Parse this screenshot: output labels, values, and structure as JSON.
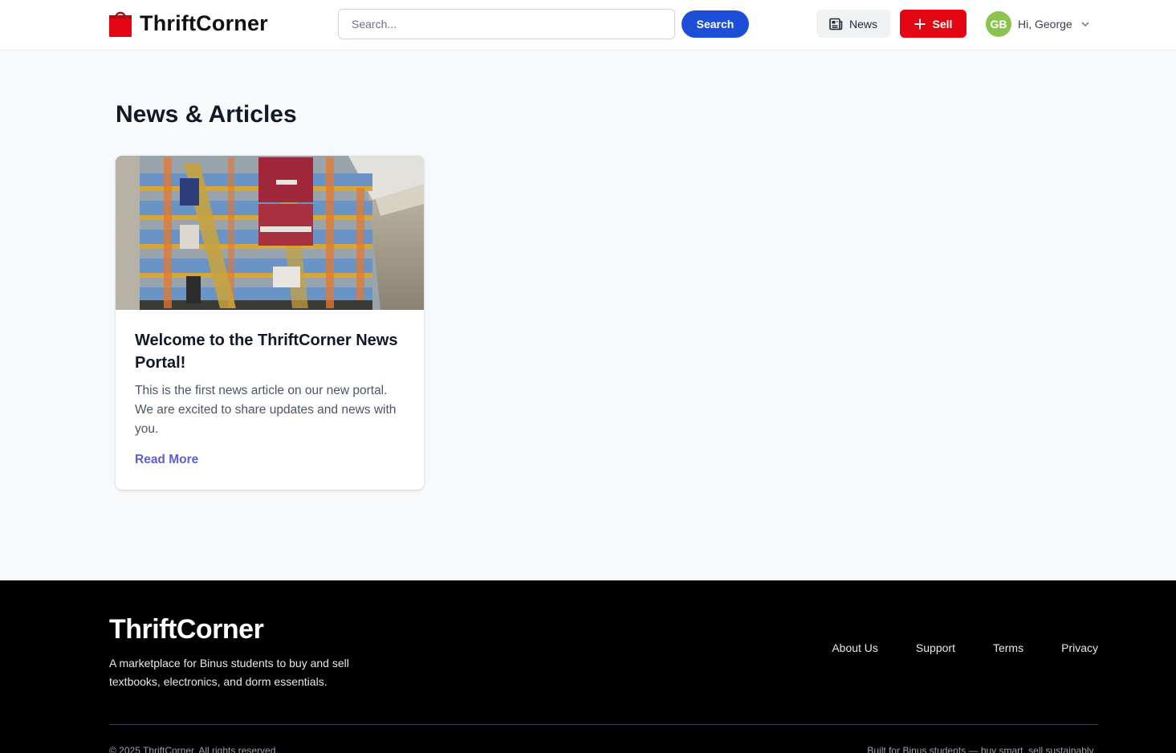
{
  "header": {
    "brand": "ThriftCorner",
    "brand_color": "#e40513",
    "search": {
      "placeholder": "Search...",
      "value": ""
    },
    "search_button": "Search",
    "news_button": {
      "label": "News",
      "icon": "newspaper-icon"
    },
    "sell_button": {
      "label": "Sell",
      "icon": "plus-icon"
    },
    "user": {
      "initials": "GB",
      "greeting": "Hi, George",
      "avatar_color": "#8cc34f",
      "icon": "chevron-down-icon"
    }
  },
  "main": {
    "title": "News & Articles",
    "articles": [
      {
        "image": "photo of campus atrium interior",
        "title": "Welcome to the ThriftCorner News Portal!",
        "excerpt": "This is the first news article on our new portal. We are excited to share updates and news with you.",
        "link": "Read More"
      }
    ]
  },
  "footer": {
    "brand": "ThriftCorner",
    "tagline": "A marketplace for Binus students to buy and sell textbooks, electronics, and dorm essentials.",
    "links": [
      "About Us",
      "Support",
      "Terms",
      "Privacy"
    ],
    "copyright": "© 2025 ThriftCorner. All rights reserved.",
    "note": "Built for Binus students — buy smart, sell sustainably."
  },
  "colors": {
    "primary_blue": "#1d4ed8",
    "link_purple": "#5b5fd6",
    "footer_bg": "#000000"
  }
}
